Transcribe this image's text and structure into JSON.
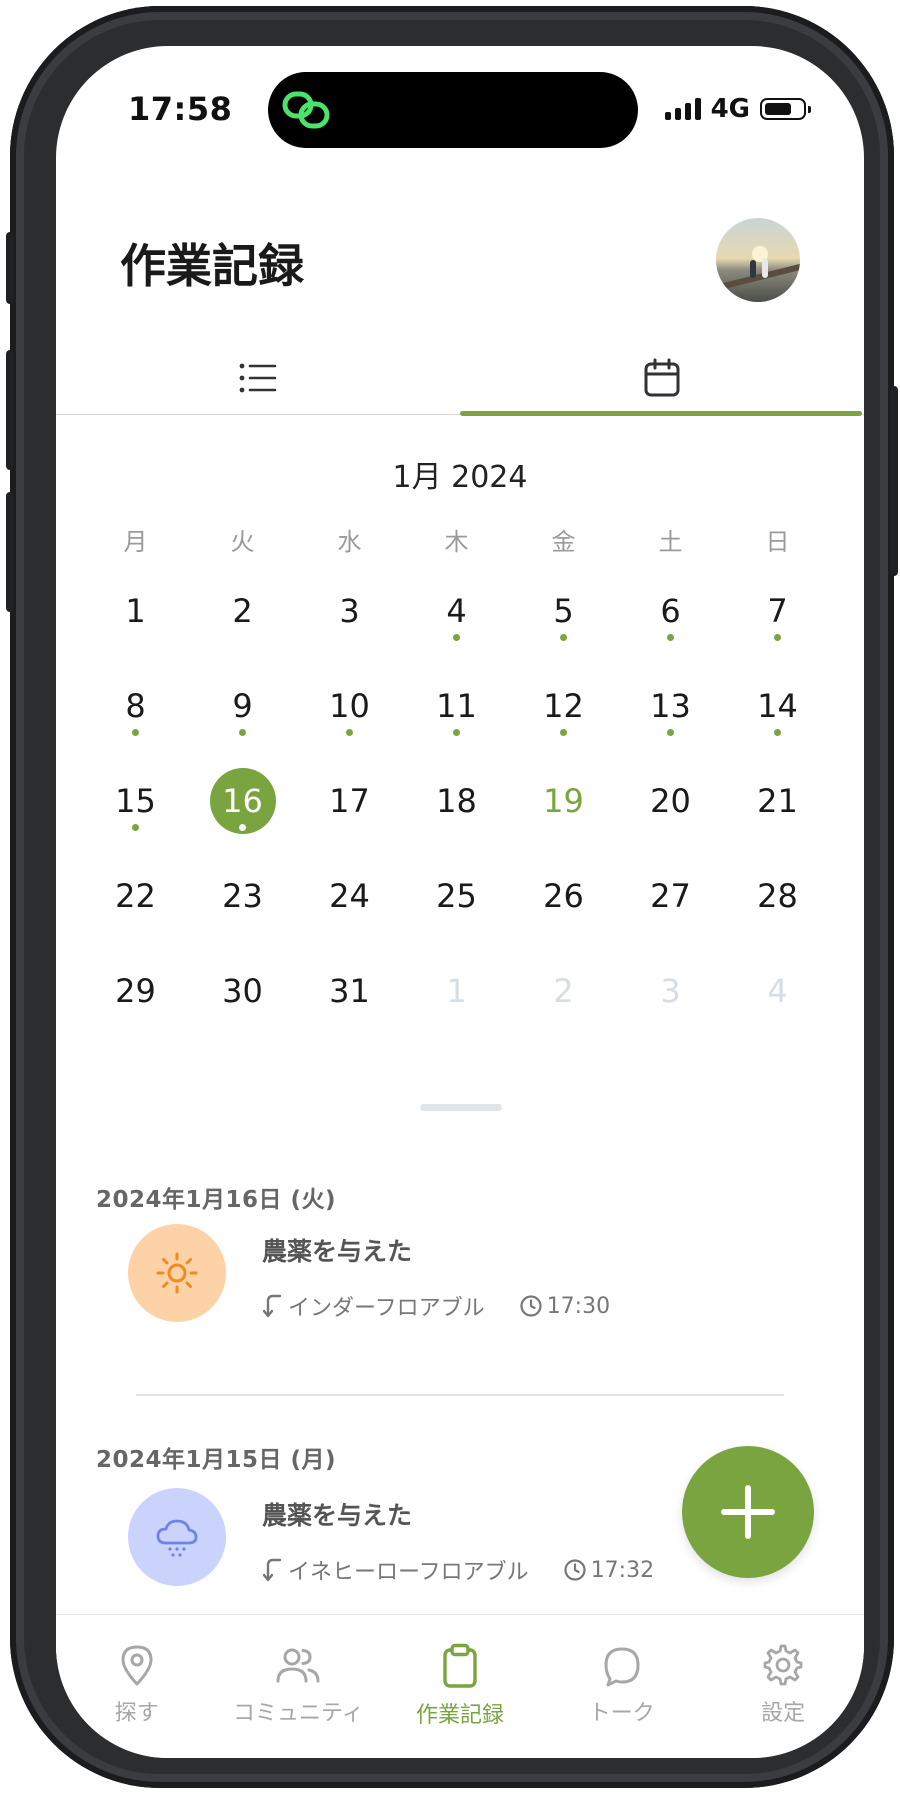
{
  "status_bar": {
    "time": "17:58",
    "network": "4G"
  },
  "header": {
    "title": "作業記録"
  },
  "tabs": {
    "list_icon": "list-icon",
    "calendar_icon": "calendar-icon",
    "active": "calendar"
  },
  "calendar": {
    "month_label": "1月 2024",
    "weekdays": [
      "月",
      "火",
      "水",
      "木",
      "金",
      "土",
      "日"
    ],
    "weeks": [
      [
        {
          "d": "1"
        },
        {
          "d": "2"
        },
        {
          "d": "3"
        },
        {
          "d": "4",
          "dot": true
        },
        {
          "d": "5",
          "dot": true
        },
        {
          "d": "6",
          "dot": true
        },
        {
          "d": "7",
          "dot": true
        }
      ],
      [
        {
          "d": "8",
          "dot": true
        },
        {
          "d": "9",
          "dot": true
        },
        {
          "d": "10",
          "dot": true
        },
        {
          "d": "11",
          "dot": true
        },
        {
          "d": "12",
          "dot": true
        },
        {
          "d": "13",
          "dot": true
        },
        {
          "d": "14",
          "dot": true
        }
      ],
      [
        {
          "d": "15",
          "dot": true
        },
        {
          "d": "16",
          "dot": true,
          "selected": true
        },
        {
          "d": "17"
        },
        {
          "d": "18"
        },
        {
          "d": "19",
          "today": true
        },
        {
          "d": "20"
        },
        {
          "d": "21"
        }
      ],
      [
        {
          "d": "22"
        },
        {
          "d": "23"
        },
        {
          "d": "24"
        },
        {
          "d": "25"
        },
        {
          "d": "26"
        },
        {
          "d": "27"
        },
        {
          "d": "28"
        }
      ],
      [
        {
          "d": "29"
        },
        {
          "d": "30"
        },
        {
          "d": "31"
        },
        {
          "d": "1",
          "other": true
        },
        {
          "d": "2",
          "other": true
        },
        {
          "d": "3",
          "other": true
        },
        {
          "d": "4",
          "other": true
        }
      ]
    ]
  },
  "records": [
    {
      "date": "2024年1月16日 (火)",
      "title": "農薬を与えた",
      "product": "インダーフロアブル",
      "time": "17:30",
      "weather_icon": "sun-icon",
      "icon_bg": "#fdd2a7",
      "icon_color": "#f08a24"
    },
    {
      "date": "2024年1月15日 (月)",
      "title": "農薬を与えた",
      "product": "イネヒーローフロアブル",
      "time": "17:32",
      "weather_icon": "snow-cloud-icon",
      "icon_bg": "#c9d3fc",
      "icon_color": "#6f84e6"
    }
  ],
  "fab": {
    "icon": "plus-icon"
  },
  "bottom_nav": [
    {
      "label": "探す",
      "icon": "map-pin-icon"
    },
    {
      "label": "コミュニティ",
      "icon": "users-icon"
    },
    {
      "label": "作業記録",
      "icon": "clipboard-icon",
      "active": true
    },
    {
      "label": "トーク",
      "icon": "chat-bubble-icon"
    },
    {
      "label": "設定",
      "icon": "gear-icon"
    }
  ],
  "colors": {
    "accent": "#7aa43f",
    "muted": "#a7a7a7",
    "other_month": "#d6dde3"
  }
}
